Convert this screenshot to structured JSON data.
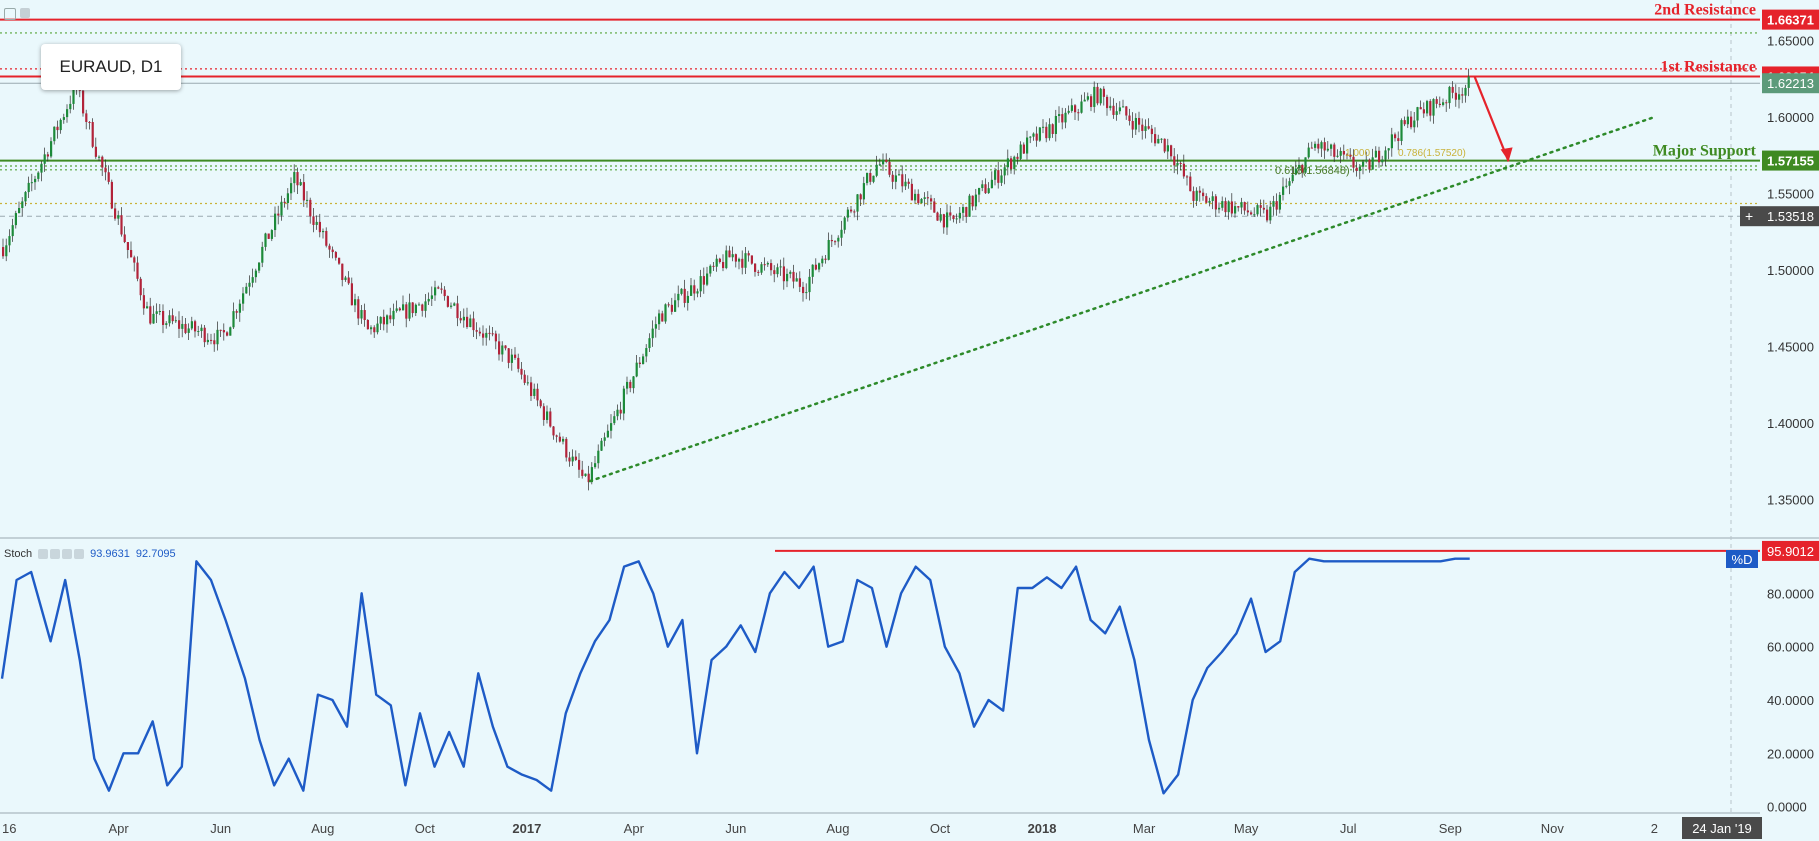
{
  "symbol_label": "EURAUD, D1",
  "indicator": {
    "name": "Stoch",
    "k_value": "93.9631",
    "d_value": "92.7095",
    "badge": "%D"
  },
  "date_badge": "24 Jan '19",
  "colors": {
    "bull": "#1d8a3a",
    "bear": "#b2233a",
    "resistance": "#e5232b",
    "support": "#3f8a22",
    "stoch": "#1e5bc6",
    "background": "#eaf8fc"
  },
  "chart_data": [
    {
      "type": "candlestick",
      "ylim": [
        1.33,
        1.67
      ],
      "y_ticks": [
        "1.65000",
        "1.60000",
        "1.55000",
        "1.50000",
        "1.45000",
        "1.40000",
        "1.35000"
      ],
      "y_tick_values": [
        1.65,
        1.6,
        1.55,
        1.5,
        1.45,
        1.4,
        1.35
      ],
      "x_ticks": [
        "16",
        "Apr",
        "Jun",
        "Aug",
        "Oct",
        "2017",
        "Apr",
        "Jun",
        "Aug",
        "Oct",
        "2018",
        "Mar",
        "May",
        "Jul",
        "Sep",
        "Nov",
        "2",
        "24 Jan '19"
      ],
      "x_tick_positions": [
        0,
        2.4,
        4.5,
        6.6,
        8.7,
        10.8,
        13.0,
        15.1,
        17.2,
        19.3,
        21.4,
        23.5,
        25.6,
        27.7,
        29.8,
        31.9,
        34.0,
        34.8
      ],
      "x_tick_bold": [
        "2017",
        "2018"
      ],
      "path_months": [
        0,
        1.5,
        3,
        4.5,
        6,
        7.5,
        9,
        10.5,
        12,
        13.5,
        15,
        16.5,
        18,
        19.5,
        21,
        22.5,
        24,
        24.5,
        26,
        27,
        28,
        29,
        30.2
      ],
      "path_prices": [
        1.515,
        1.62,
        1.47,
        1.455,
        1.56,
        1.46,
        1.485,
        1.44,
        1.36,
        1.47,
        1.51,
        1.49,
        1.57,
        1.53,
        1.58,
        1.615,
        1.58,
        1.548,
        1.535,
        1.582,
        1.565,
        1.6,
        1.622
      ],
      "levels": [
        {
          "label": "2nd Resistance",
          "value": 1.66371,
          "value_label": "1.66371",
          "role": "resistance"
        },
        {
          "label": "1st Resistance",
          "value": 1.62654,
          "value_label": "1.62654",
          "role": "resistance"
        },
        {
          "label": "Major Support",
          "value": 1.57155,
          "value_label": "1.57155",
          "role": "support"
        }
      ],
      "current_price": {
        "value": 1.62213,
        "value_label": "1.62213"
      },
      "crosshair": {
        "value": 1.53518,
        "value_label": "1.53518"
      },
      "fib_labels": [
        "0.618(1.56848)",
        "0.786(1.57520)",
        "1.000"
      ],
      "trendline": {
        "from": [
          12.1,
          1.362
        ],
        "to": [
          34.0,
          1.6
        ]
      },
      "projection": {
        "from": [
          30.3,
          1.6265
        ],
        "to": [
          31.0,
          1.571
        ]
      }
    },
    {
      "type": "line",
      "name": "Stoch",
      "ylim": [
        -2,
        100
      ],
      "y_ticks": [
        "80.0000",
        "60.0000",
        "40.0000",
        "20.0000",
        "0.0000"
      ],
      "y_tick_values": [
        80,
        60,
        40,
        20,
        0
      ],
      "level": {
        "value": 95.9012,
        "value_label": "95.9012"
      },
      "x": [
        0,
        0.3,
        0.6,
        1.0,
        1.3,
        1.6,
        1.9,
        2.2,
        2.5,
        2.8,
        3.1,
        3.4,
        3.7,
        4.0,
        4.3,
        4.6,
        5.0,
        5.3,
        5.6,
        5.9,
        6.2,
        6.5,
        6.8,
        7.1,
        7.4,
        7.7,
        8.0,
        8.3,
        8.6,
        8.9,
        9.2,
        9.5,
        9.8,
        10.1,
        10.4,
        10.7,
        11.0,
        11.3,
        11.6,
        11.9,
        12.2,
        12.5,
        12.8,
        13.1,
        13.4,
        13.7,
        14.0,
        14.3,
        14.6,
        14.9,
        15.2,
        15.5,
        15.8,
        16.1,
        16.4,
        16.7,
        17.0,
        17.3,
        17.6,
        17.9,
        18.2,
        18.5,
        18.8,
        19.1,
        19.4,
        19.7,
        20.0,
        20.3,
        20.6,
        20.9,
        21.2,
        21.5,
        21.8,
        22.1,
        22.4,
        22.7,
        23.0,
        23.3,
        23.6,
        23.9,
        24.2,
        24.5,
        24.8,
        25.1,
        25.4,
        25.7,
        26.0,
        26.3,
        26.6,
        26.9,
        27.2,
        27.5,
        27.8,
        28.1,
        28.4,
        28.7,
        29.0,
        29.3,
        29.6,
        29.9,
        30.2
      ],
      "values": [
        48,
        85,
        88,
        62,
        85,
        55,
        18,
        6,
        20,
        20,
        32,
        8,
        15,
        92,
        85,
        70,
        48,
        25,
        8,
        18,
        6,
        42,
        40,
        30,
        80,
        42,
        38,
        8,
        35,
        15,
        28,
        15,
        50,
        30,
        15,
        12,
        10,
        6,
        35,
        50,
        62,
        70,
        90,
        92,
        80,
        60,
        70,
        20,
        55,
        60,
        68,
        58,
        80,
        88,
        82,
        90,
        60,
        62,
        85,
        82,
        60,
        80,
        90,
        85,
        60,
        50,
        30,
        40,
        36,
        82,
        82,
        86,
        82,
        90,
        70,
        65,
        75,
        55,
        25,
        5,
        12,
        40,
        52,
        58,
        65,
        78,
        58,
        62,
        88,
        93,
        92,
        92,
        92,
        92,
        92,
        92,
        92,
        92,
        92,
        93,
        93
      ]
    }
  ]
}
